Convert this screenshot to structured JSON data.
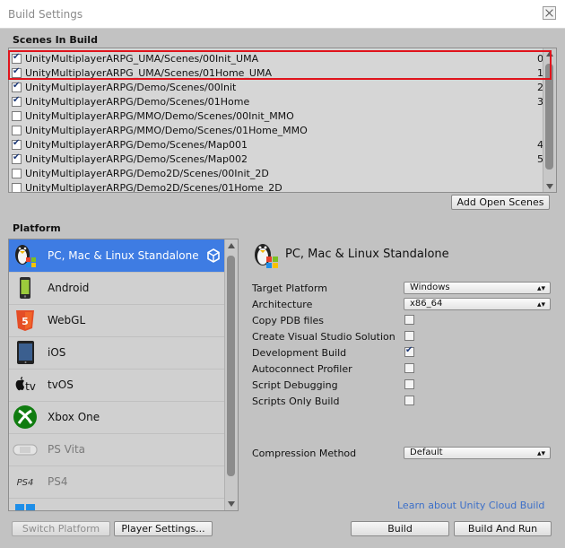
{
  "window": {
    "title": "Build Settings"
  },
  "scenes": {
    "header": "Scenes In Build",
    "items": [
      {
        "checked": true,
        "path": "UnityMultiplayerARPG_UMA/Scenes/00Init_UMA",
        "index": "0"
      },
      {
        "checked": true,
        "path": "UnityMultiplayerARPG_UMA/Scenes/01Home_UMA",
        "index": "1"
      },
      {
        "checked": true,
        "path": "UnityMultiplayerARPG/Demo/Scenes/00Init",
        "index": "2"
      },
      {
        "checked": true,
        "path": "UnityMultiplayerARPG/Demo/Scenes/01Home",
        "index": "3"
      },
      {
        "checked": false,
        "path": "UnityMultiplayerARPG/MMO/Demo/Scenes/00Init_MMO",
        "index": ""
      },
      {
        "checked": false,
        "path": "UnityMultiplayerARPG/MMO/Demo/Scenes/01Home_MMO",
        "index": ""
      },
      {
        "checked": true,
        "path": "UnityMultiplayerARPG/Demo/Scenes/Map001",
        "index": "4"
      },
      {
        "checked": true,
        "path": "UnityMultiplayerARPG/Demo/Scenes/Map002",
        "index": "5"
      },
      {
        "checked": false,
        "path": "UnityMultiplayerARPG/Demo2D/Scenes/00Init_2D",
        "index": ""
      },
      {
        "checked": false,
        "path": "UnityMultiplayerARPG/Demo2D/Scenes/01Home_2D",
        "index": ""
      }
    ],
    "add_open_scenes_label": "Add Open Scenes"
  },
  "platform": {
    "header": "Platform",
    "items": [
      {
        "label": "PC, Mac & Linux Standalone",
        "icon": "pc-penguin-icon",
        "selected": true,
        "dim": false
      },
      {
        "label": "Android",
        "icon": "android-icon",
        "selected": false,
        "dim": false
      },
      {
        "label": "WebGL",
        "icon": "html5-icon",
        "selected": false,
        "dim": false
      },
      {
        "label": "iOS",
        "icon": "ipad-icon",
        "selected": false,
        "dim": false
      },
      {
        "label": "tvOS",
        "icon": "apple-tv-icon",
        "selected": false,
        "dim": false
      },
      {
        "label": "Xbox One",
        "icon": "xbox-icon",
        "selected": false,
        "dim": false
      },
      {
        "label": "PS Vita",
        "icon": "ps-vita-icon",
        "selected": false,
        "dim": true
      },
      {
        "label": "PS4",
        "icon": "ps4-icon",
        "selected": false,
        "dim": true
      },
      {
        "label": "",
        "icon": "windows-icon",
        "selected": false,
        "dim": false
      }
    ]
  },
  "settings": {
    "title": "PC, Mac & Linux Standalone",
    "target_platform_label": "Target Platform",
    "target_platform_value": "Windows",
    "architecture_label": "Architecture",
    "architecture_value": "x86_64",
    "copy_pdb_label": "Copy PDB files",
    "copy_pdb_checked": false,
    "create_vs_label": "Create Visual Studio Solution",
    "create_vs_checked": false,
    "dev_build_label": "Development Build",
    "dev_build_checked": true,
    "autoconnect_label": "Autoconnect Profiler",
    "autoconnect_checked": false,
    "script_debug_label": "Script Debugging",
    "script_debug_checked": false,
    "scripts_only_label": "Scripts Only Build",
    "scripts_only_checked": false,
    "compression_label": "Compression Method",
    "compression_value": "Default"
  },
  "footer": {
    "cloud_link": "Learn about Unity Cloud Build",
    "switch_platform_label": "Switch Platform",
    "player_settings_label": "Player Settings...",
    "build_label": "Build",
    "build_and_run_label": "Build And Run"
  },
  "colors": {
    "selection": "#3e7ce3",
    "highlight_box": "#e0141c",
    "link": "#3c6fc8"
  }
}
